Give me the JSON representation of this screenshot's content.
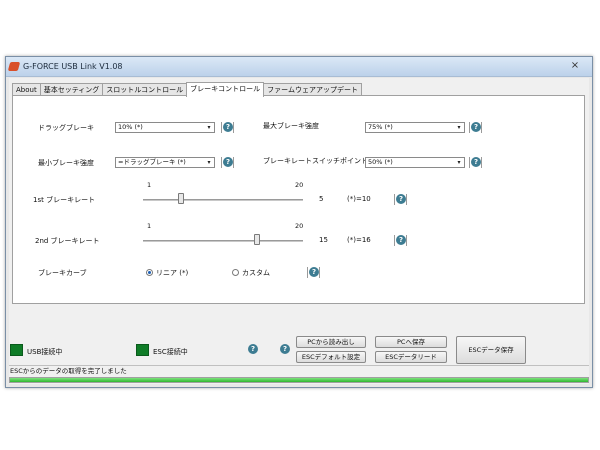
{
  "window": {
    "title": "G-FORCE USB Link V1.08",
    "close_symbol": "×"
  },
  "tabs": [
    {
      "label": "About",
      "active": false
    },
    {
      "label": "基本セッティング",
      "active": false
    },
    {
      "label": "スロットルコントロール",
      "active": false
    },
    {
      "label": "ブレーキコントロール",
      "active": true
    },
    {
      "label": "ファームウェアアップデート",
      "active": false
    }
  ],
  "brake": {
    "drag_brake": {
      "label": "ドラッグブレーキ",
      "value": "10% (*)"
    },
    "max_brake": {
      "label": "最大ブレーキ強度",
      "value": "75% (*)"
    },
    "min_brake": {
      "label": "最小ブレーキ強度",
      "value": "=ドラッグブレーキ (*)"
    },
    "brake_rate_switch": {
      "label": "ブレーキレートスイッチポイント",
      "value": "50% (*)"
    },
    "first_rate": {
      "label": "1st ブレーキレート",
      "min": "1",
      "max": "20",
      "value": 5,
      "value_text": "5",
      "default_text": "(*)=10"
    },
    "second_rate": {
      "label": "2nd ブレーキレート",
      "min": "1",
      "max": "20",
      "value": 15,
      "value_text": "15",
      "default_text": "(*)=16"
    },
    "curve": {
      "label": "ブレーキカーブ",
      "options": [
        "リニア (*)",
        "カスタム"
      ],
      "selected": 0
    }
  },
  "bottom": {
    "usb_status": "USB接続中",
    "esc_status": "ESC接続中",
    "status_color": "#0f7c27",
    "btn_load_pc": "PCから読み出し",
    "btn_save_pc": "PCへ保存",
    "btn_esc_default": "ESCデフォルト設定",
    "btn_esc_read": "ESCデータリード",
    "btn_esc_save": "ESCデータ保存"
  },
  "status_bar": {
    "text": "ESCからのデータの取得を完了しました"
  },
  "progress": {
    "value": 1.0
  },
  "icons": {
    "help": "help-icon",
    "dropdown": "chevron-down-icon",
    "app": "app-logo-icon"
  },
  "help_glyph": "?",
  "arrow_glyph": "▾",
  "accent_color": "#3d7c92"
}
